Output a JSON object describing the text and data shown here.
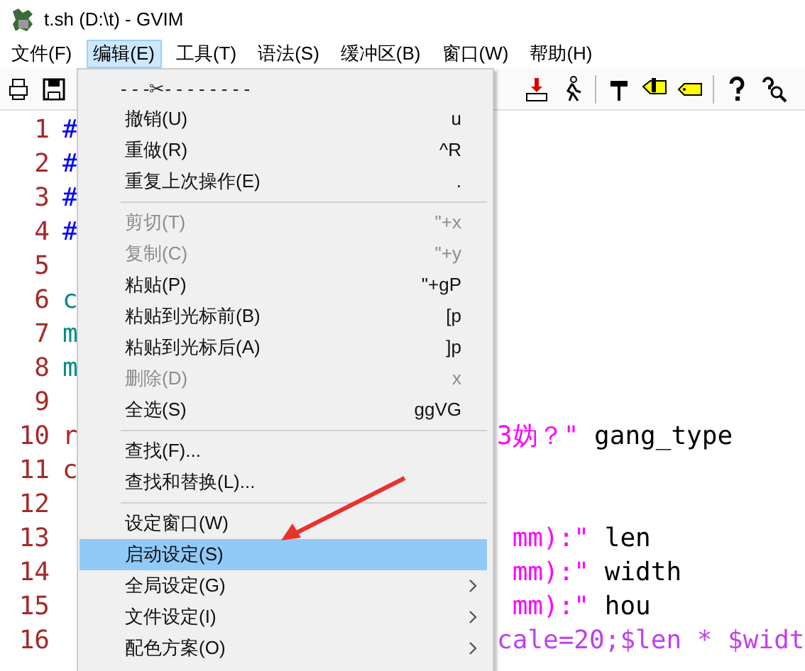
{
  "window": {
    "title": "t.sh (D:\\t) - GVIM"
  },
  "menubar": [
    {
      "label": "文件(F)",
      "selected": false
    },
    {
      "label": "编辑(E)",
      "selected": true
    },
    {
      "label": "工具(T)",
      "selected": false
    },
    {
      "label": "语法(S)",
      "selected": false
    },
    {
      "label": "缓冲区(B)",
      "selected": false
    },
    {
      "label": "窗口(W)",
      "selected": false
    },
    {
      "label": "帮助(H)",
      "selected": false
    }
  ],
  "editor": {
    "lines": [
      {
        "number": "1",
        "before_menu": [
          {
            "kind": "comment",
            "text": "#"
          }
        ]
      },
      {
        "number": "2",
        "before_menu": [
          {
            "kind": "comment",
            "text": "#"
          }
        ]
      },
      {
        "number": "3",
        "before_menu": [
          {
            "kind": "comment",
            "text": "#"
          }
        ]
      },
      {
        "number": "4",
        "before_menu": [
          {
            "kind": "comment",
            "text": "#"
          }
        ]
      },
      {
        "number": "5"
      },
      {
        "number": "6",
        "before_menu": [
          {
            "kind": "identifier",
            "text": "c"
          }
        ]
      },
      {
        "number": "7",
        "before_menu": [
          {
            "kind": "identifier",
            "text": "m"
          }
        ]
      },
      {
        "number": "8",
        "before_menu": [
          {
            "kind": "identifier",
            "text": "m"
          }
        ]
      },
      {
        "number": "9"
      },
      {
        "number": "10",
        "before_menu": [
          {
            "kind": "statement",
            "text": "r"
          }
        ],
        "after_menu": [
          {
            "kind": "string",
            "text": "3妫？\""
          },
          {
            "kind": "plain",
            "text": " gang_type"
          }
        ]
      },
      {
        "number": "11",
        "before_menu": [
          {
            "kind": "statement",
            "text": "c"
          }
        ]
      },
      {
        "number": "12"
      },
      {
        "number": "13",
        "after_menu": [
          {
            "kind": "string",
            "text": " mm):\""
          },
          {
            "kind": "plain",
            "text": " len"
          }
        ]
      },
      {
        "number": "14",
        "after_menu": [
          {
            "kind": "string",
            "text": " mm):\""
          },
          {
            "kind": "plain",
            "text": " width"
          }
        ]
      },
      {
        "number": "15",
        "after_menu": [
          {
            "kind": "string",
            "text": " mm):\""
          },
          {
            "kind": "plain",
            "text": " hou"
          }
        ]
      },
      {
        "number": "16",
        "after_menu": [
          {
            "kind": "special",
            "text": "cale=20;$len * $widt"
          }
        ]
      }
    ]
  },
  "edit_menu": {
    "items": [
      {
        "kind": "tearoff",
        "label": "- - -✂- - - - - - - -"
      },
      {
        "kind": "item",
        "label": "撤销(U)",
        "shortcut": "u",
        "disabled": false,
        "selected": false,
        "submenu": false
      },
      {
        "kind": "item",
        "label": "重做(R)",
        "shortcut": "^R",
        "disabled": false,
        "selected": false,
        "submenu": false
      },
      {
        "kind": "item",
        "label": "重复上次操作(E)",
        "shortcut": ".",
        "disabled": false,
        "selected": false,
        "submenu": false
      },
      {
        "kind": "separator"
      },
      {
        "kind": "item",
        "label": "剪切(T)",
        "shortcut": "\"+x",
        "disabled": true,
        "selected": false,
        "submenu": false
      },
      {
        "kind": "item",
        "label": "复制(C)",
        "shortcut": "\"+y",
        "disabled": true,
        "selected": false,
        "submenu": false
      },
      {
        "kind": "item",
        "label": "粘贴(P)",
        "shortcut": "\"+gP",
        "disabled": false,
        "selected": false,
        "submenu": false
      },
      {
        "kind": "item",
        "label": "粘贴到光标前(B)",
        "shortcut": "[p",
        "disabled": false,
        "selected": false,
        "submenu": false
      },
      {
        "kind": "item",
        "label": "粘贴到光标后(A)",
        "shortcut": "]p",
        "disabled": false,
        "selected": false,
        "submenu": false
      },
      {
        "kind": "item",
        "label": "删除(D)",
        "shortcut": "x",
        "disabled": true,
        "selected": false,
        "submenu": false
      },
      {
        "kind": "item",
        "label": "全选(S)",
        "shortcut": "ggVG",
        "disabled": false,
        "selected": false,
        "submenu": false
      },
      {
        "kind": "separator"
      },
      {
        "kind": "item",
        "label": "查找(F)...",
        "disabled": false,
        "selected": false,
        "submenu": false
      },
      {
        "kind": "item",
        "label": "查找和替换(L)...",
        "disabled": false,
        "selected": false,
        "submenu": false
      },
      {
        "kind": "separator"
      },
      {
        "kind": "item",
        "label": "设定窗口(W)",
        "disabled": false,
        "selected": false,
        "submenu": false
      },
      {
        "kind": "item",
        "label": "启动设定(S)",
        "disabled": false,
        "selected": true,
        "submenu": false
      },
      {
        "kind": "item",
        "label": "全局设定(G)",
        "disabled": false,
        "selected": false,
        "submenu": true
      },
      {
        "kind": "item",
        "label": "文件设定(I)",
        "disabled": false,
        "selected": false,
        "submenu": true
      },
      {
        "kind": "item",
        "label": "配色方案(O)",
        "disabled": false,
        "selected": false,
        "submenu": true
      }
    ]
  }
}
